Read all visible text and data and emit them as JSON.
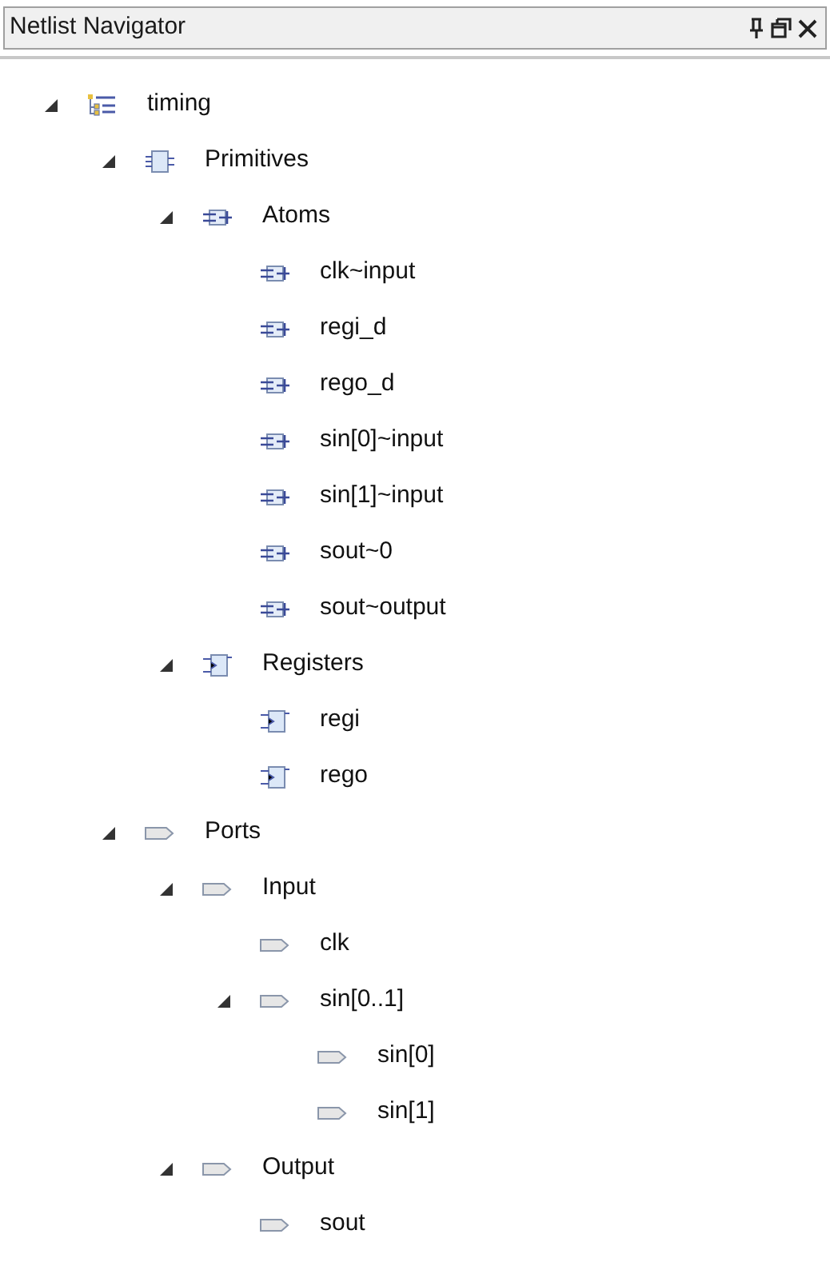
{
  "panel": {
    "title": "Netlist Navigator"
  },
  "tree": [
    {
      "label": "timing",
      "kind": "design",
      "expanded": true,
      "children": [
        {
          "label": "Primitives",
          "kind": "primitives",
          "expanded": true,
          "children": [
            {
              "label": "Atoms",
              "kind": "atom",
              "expanded": true,
              "children": [
                {
                  "label": "clk~input",
                  "kind": "atom"
                },
                {
                  "label": "regi_d",
                  "kind": "atom"
                },
                {
                  "label": "rego_d",
                  "kind": "atom"
                },
                {
                  "label": "sin[0]~input",
                  "kind": "atom"
                },
                {
                  "label": "sin[1]~input",
                  "kind": "atom"
                },
                {
                  "label": "sout~0",
                  "kind": "atom"
                },
                {
                  "label": "sout~output",
                  "kind": "atom"
                }
              ]
            },
            {
              "label": "Registers",
              "kind": "register",
              "expanded": true,
              "children": [
                {
                  "label": "regi",
                  "kind": "register"
                },
                {
                  "label": "rego",
                  "kind": "register"
                }
              ]
            }
          ]
        },
        {
          "label": "Ports",
          "kind": "port",
          "expanded": true,
          "children": [
            {
              "label": "Input",
              "kind": "port",
              "expanded": true,
              "children": [
                {
                  "label": "clk",
                  "kind": "port"
                },
                {
                  "label": "sin[0..1]",
                  "kind": "port",
                  "expanded": true,
                  "children": [
                    {
                      "label": "sin[0]",
                      "kind": "port"
                    },
                    {
                      "label": "sin[1]",
                      "kind": "port"
                    }
                  ]
                }
              ]
            },
            {
              "label": "Output",
              "kind": "port",
              "expanded": true,
              "children": [
                {
                  "label": "sout",
                  "kind": "port"
                }
              ]
            }
          ]
        }
      ]
    }
  ]
}
